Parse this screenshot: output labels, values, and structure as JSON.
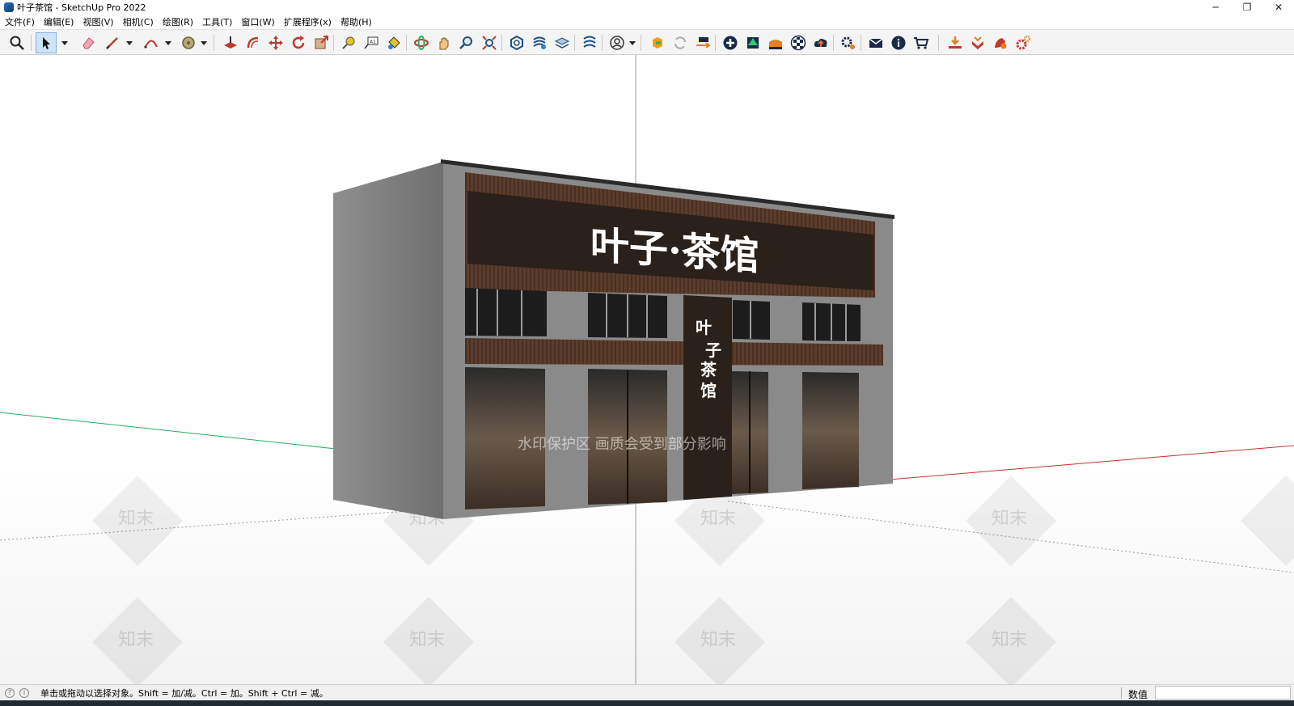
{
  "window": {
    "title": "叶子茶馆 - SketchUp Pro 2022",
    "minimize_glyph": "─",
    "maximize_glyph": "❐",
    "close_glyph": "✕"
  },
  "menu": [
    {
      "label": "文件(F)"
    },
    {
      "label": "编辑(E)"
    },
    {
      "label": "视图(V)"
    },
    {
      "label": "相机(C)"
    },
    {
      "label": "绘图(R)"
    },
    {
      "label": "工具(T)"
    },
    {
      "label": "窗口(W)"
    },
    {
      "label": "扩展程序(x)"
    },
    {
      "label": "帮助(H)"
    }
  ],
  "toolbar": {
    "tools": [
      {
        "icon": "zoom-extents-icon"
      },
      {
        "icon": "select-icon",
        "active": true
      },
      {
        "icon": "eraser-icon"
      },
      {
        "icon": "pencil-line-icon"
      },
      {
        "icon": "arc-icon"
      },
      {
        "icon": "circle-shape-icon"
      },
      {
        "icon": "push-pull-icon"
      },
      {
        "icon": "offset-icon"
      },
      {
        "icon": "move-icon"
      },
      {
        "icon": "rotate-icon"
      },
      {
        "icon": "scale-icon"
      },
      {
        "icon": "tape-measure-icon"
      },
      {
        "icon": "text-icon"
      },
      {
        "icon": "paint-bucket-icon"
      },
      {
        "icon": "orbit-icon"
      },
      {
        "icon": "pan-icon"
      },
      {
        "icon": "zoom-icon"
      },
      {
        "icon": "zoom-window-icon"
      },
      {
        "icon": "warehouse-icon"
      },
      {
        "icon": "extension-warehouse-icon"
      },
      {
        "icon": "layout-icon"
      },
      {
        "icon": "extension-manager-icon"
      },
      {
        "icon": "account-icon"
      },
      {
        "icon": "plugin-a-icon"
      },
      {
        "icon": "refresh-icon"
      },
      {
        "icon": "plugin-b-icon"
      },
      {
        "icon": "plus-circle-icon"
      },
      {
        "icon": "tree-icon"
      },
      {
        "icon": "terrain-icon"
      },
      {
        "icon": "checker-icon"
      },
      {
        "icon": "cloud-upload-icon"
      },
      {
        "icon": "settings-icon"
      },
      {
        "icon": "mail-icon"
      },
      {
        "icon": "info-icon"
      },
      {
        "icon": "cart-icon"
      },
      {
        "icon": "download-tray-icon"
      },
      {
        "icon": "red-arrow-icon"
      },
      {
        "icon": "plugin-c-icon"
      },
      {
        "icon": "gear-red-icon"
      }
    ]
  },
  "scene": {
    "sign_main": "叶子·茶馆",
    "sign_vertical": [
      "叶",
      "子",
      "茶",
      "馆"
    ],
    "watermark_text": "水印保护区 画质会受到部分影响",
    "watermark_logo": "知末"
  },
  "statusbar": {
    "message": "单击或拖动以选择对象。Shift = 加/减。Ctrl = 加。Shift + Ctrl = 减。",
    "value_label": "数值",
    "value": ""
  },
  "colors": {
    "toolbar_bg": "#f4f4f4",
    "facade_brown": "#4a3428",
    "wall_gray": "#8a8a8a",
    "red_axis": "#c0392b",
    "green_axis": "#27ae60"
  }
}
